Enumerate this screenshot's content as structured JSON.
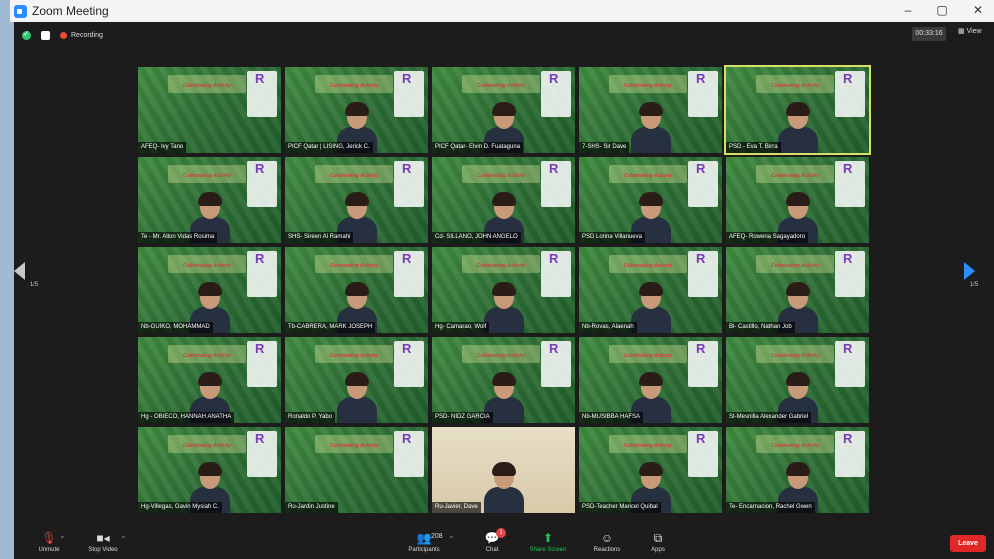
{
  "window": {
    "title": "Zoom Meeting",
    "controls": [
      "–",
      "▢",
      "✕"
    ]
  },
  "topbar": {
    "recording_label": "Recording",
    "timer": "00:33:16",
    "view_label": "View"
  },
  "pager": {
    "left": "1/5",
    "right": "1/5"
  },
  "banner_text": "Culminating Activity",
  "participants": [
    {
      "name": "AFEQ- Ivy Tano",
      "face": false
    },
    {
      "name": "PICF Qatar | LISING, Jerick C.",
      "face": true
    },
    {
      "name": "PICF Qatar- Elvin D. Fuataguna",
      "face": true
    },
    {
      "name": "7-SHS- Sir Dave",
      "face": true
    },
    {
      "name": "PSD - Eva T. Birra",
      "face": true,
      "active": true
    },
    {
      "name": "Te - Mr. Allon Vidas Rosima",
      "face": true
    },
    {
      "name": "SHS- Sireen Al Ramahi",
      "face": true
    },
    {
      "name": "Cd- SILLANO, JOHN ANGELO",
      "face": true
    },
    {
      "name": "PSD Lorina Villanueva",
      "face": true
    },
    {
      "name": "AFEQ- Rowena Sagayadoro",
      "face": true
    },
    {
      "name": "Nb-GUIKO, MOHAMMAD",
      "face": true
    },
    {
      "name": "Tb-CABRERA, MARK JOSEPH",
      "face": true
    },
    {
      "name": "Hg- Camarao, Wolf",
      "face": true
    },
    {
      "name": "Nb-Rovas, Alaenah",
      "face": true
    },
    {
      "name": "Bl- Castillo, Nathan Job",
      "face": true
    },
    {
      "name": "Hg - OBIECO, HANNAH ANATHA",
      "face": true
    },
    {
      "name": "Ronaldo P. Yabo",
      "face": true
    },
    {
      "name": "PSD- NIDZ GARCIA",
      "face": true
    },
    {
      "name": "Nb-MUSIBBA HAFSA",
      "face": true
    },
    {
      "name": "St-Mesnilla Alexander Gabriel",
      "face": true
    },
    {
      "name": "Hg-Villegas, Gavin Mysiah C.",
      "face": true
    },
    {
      "name": "Ru-Jardin Justine",
      "face": false
    },
    {
      "name": "Ru-Javier, Dave",
      "face": true,
      "plain": true
    },
    {
      "name": "PSD-Teacher Maricel Quibal",
      "face": true
    },
    {
      "name": "Te- Encarnacion, Rachel Gwen",
      "face": true
    }
  ],
  "toolbar": {
    "unmute": "Unmute",
    "stop_video": "Stop Video",
    "participants": "Participants",
    "participants_count": "208",
    "chat": "Chat",
    "chat_badge": "1",
    "share": "Share Screen",
    "reactions": "Reactions",
    "apps": "Apps",
    "leave": "Leave"
  }
}
